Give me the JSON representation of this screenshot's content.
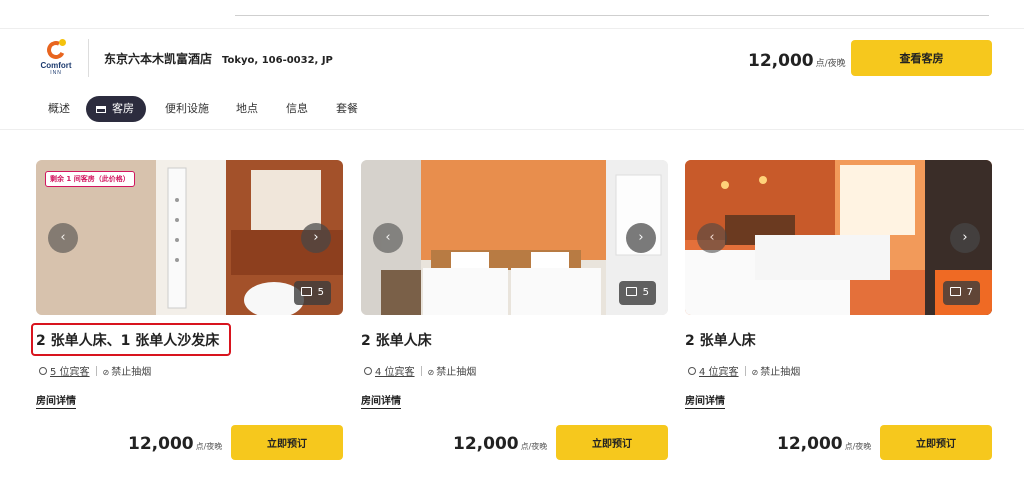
{
  "hotel": {
    "logo_word": "Comfort",
    "logo_sub": "INN",
    "name": "东京六本木凯富酒店",
    "address": "Tokyo, 106-0032, JP",
    "price": "12,000",
    "price_unit": "点/夜晚",
    "view_rooms": "查看客房"
  },
  "nav": {
    "tabs": [
      "概述",
      "客房",
      "便利设施",
      "地点",
      "信息",
      "套餐"
    ],
    "active": "客房"
  },
  "rooms": [
    {
      "badge": "剩余 1 间客房（此价格）",
      "photo_count": "5",
      "title": "2 张单人床、1 张单人沙发床",
      "guests": "5 位宾客",
      "smoking": "禁止抽烟",
      "details": "房间详情",
      "price": "12,000",
      "price_unit": "点/夜晚",
      "book": "立即预订"
    },
    {
      "photo_count": "5",
      "title": "2 张单人床",
      "guests": "4 位宾客",
      "smoking": "禁止抽烟",
      "details": "房间详情",
      "price": "12,000",
      "price_unit": "点/夜晚",
      "book": "立即预订"
    },
    {
      "photo_count": "7",
      "title": "2 张单人床",
      "guests": "4 位宾客",
      "smoking": "禁止抽烟",
      "details": "房间详情",
      "price": "12,000",
      "price_unit": "点/夜晚",
      "book": "立即预订"
    }
  ],
  "icons": {
    "prev": "chevron-left-icon",
    "next": "chevron-right-icon",
    "photos": "photo-gallery-icon",
    "guests": "person-icon",
    "smoking": "no-smoking-icon",
    "bed": "bed-icon"
  },
  "colors": {
    "accent": "#f6c81d",
    "nav_active": "#2c2c3e",
    "badge": "#d2165f",
    "highlight": "#d8141e"
  }
}
